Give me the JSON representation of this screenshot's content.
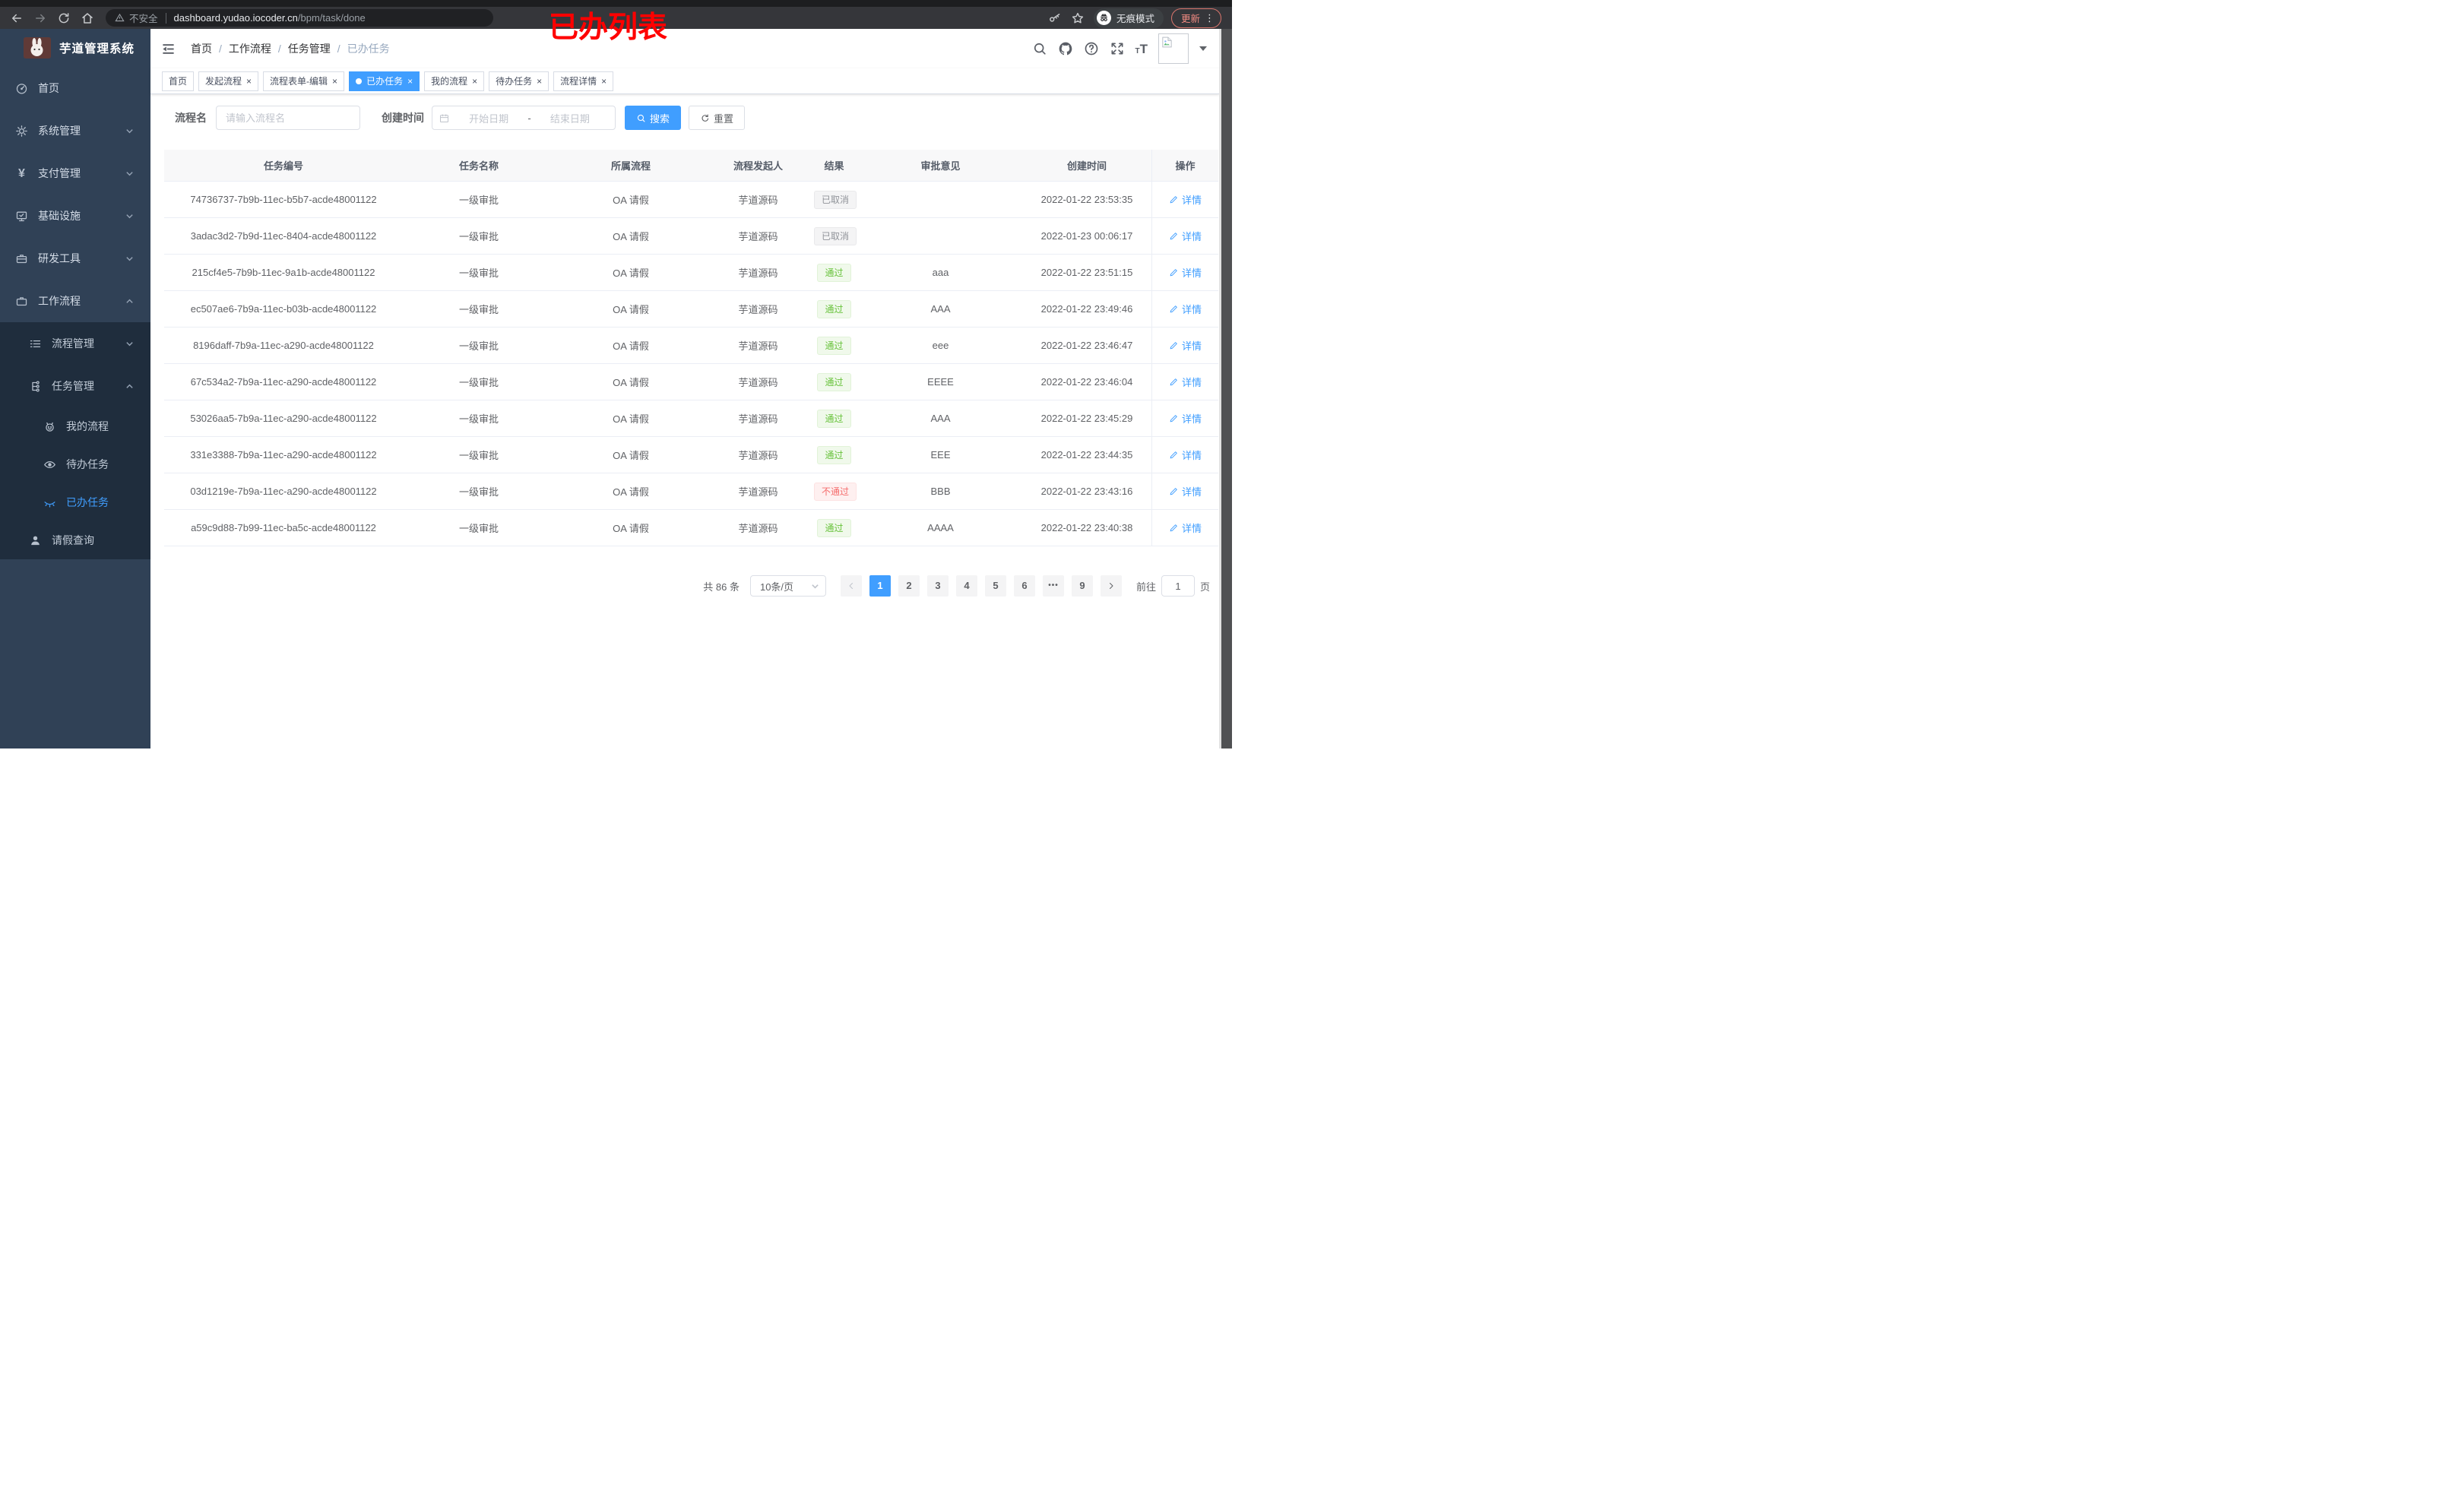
{
  "browser": {
    "security_label": "不安全",
    "url_domain": "dashboard.yudao.iocoder.cn",
    "url_path": "/bpm/task/done",
    "incognito_label": "无痕模式",
    "update_label": "更新"
  },
  "annotation": {
    "text": "已办列表",
    "color": "#ff0000"
  },
  "sidebar": {
    "title": "芋道管理系统",
    "items": {
      "home": "首页",
      "system": "系统管理",
      "pay": "支付管理",
      "infra": "基础设施",
      "dev": "研发工具",
      "workflow": "工作流程",
      "process_mgmt": "流程管理",
      "task_mgmt": "任务管理",
      "my_process": "我的流程",
      "todo": "待办任务",
      "done": "已办任务",
      "leave_query": "请假查询"
    }
  },
  "header": {
    "breadcrumbs": [
      "首页",
      "工作流程",
      "任务管理",
      "已办任务"
    ],
    "separator": "/"
  },
  "tabs": [
    {
      "label": "首页"
    },
    {
      "label": "发起流程"
    },
    {
      "label": "流程表单-编辑"
    },
    {
      "label": "已办任务",
      "active": true
    },
    {
      "label": "我的流程"
    },
    {
      "label": "待办任务"
    },
    {
      "label": "流程详情"
    }
  ],
  "filters": {
    "name_label": "流程名",
    "name_placeholder": "请输入流程名",
    "time_label": "创建时间",
    "start_placeholder": "开始日期",
    "range_separator": "-",
    "end_placeholder": "结束日期",
    "search_label": "搜索",
    "reset_label": "重置"
  },
  "table": {
    "columns": [
      "任务编号",
      "任务名称",
      "所属流程",
      "流程发起人",
      "结果",
      "审批意见",
      "创建时间",
      "操作"
    ],
    "detail_label": "详情",
    "rows": [
      {
        "id": "74736737-7b9b-11ec-b5b7-acde48001122",
        "name": "一级审批",
        "process": "OA 请假",
        "starter": "芋道源码",
        "result": "已取消",
        "result_type": "info",
        "comment": "",
        "created": "2022-01-22 23:53:35"
      },
      {
        "id": "3adac3d2-7b9d-11ec-8404-acde48001122",
        "name": "一级审批",
        "process": "OA 请假",
        "starter": "芋道源码",
        "result": "已取消",
        "result_type": "info",
        "comment": "",
        "created": "2022-01-23 00:06:17"
      },
      {
        "id": "215cf4e5-7b9b-11ec-9a1b-acde48001122",
        "name": "一级审批",
        "process": "OA 请假",
        "starter": "芋道源码",
        "result": "通过",
        "result_type": "success",
        "comment": "aaa",
        "created": "2022-01-22 23:51:15"
      },
      {
        "id": "ec507ae6-7b9a-11ec-b03b-acde48001122",
        "name": "一级审批",
        "process": "OA 请假",
        "starter": "芋道源码",
        "result": "通过",
        "result_type": "success",
        "comment": "AAA",
        "created": "2022-01-22 23:49:46"
      },
      {
        "id": "8196daff-7b9a-11ec-a290-acde48001122",
        "name": "一级审批",
        "process": "OA 请假",
        "starter": "芋道源码",
        "result": "通过",
        "result_type": "success",
        "comment": "eee",
        "created": "2022-01-22 23:46:47"
      },
      {
        "id": "67c534a2-7b9a-11ec-a290-acde48001122",
        "name": "一级审批",
        "process": "OA 请假",
        "starter": "芋道源码",
        "result": "通过",
        "result_type": "success",
        "comment": "EEEE",
        "created": "2022-01-22 23:46:04"
      },
      {
        "id": "53026aa5-7b9a-11ec-a290-acde48001122",
        "name": "一级审批",
        "process": "OA 请假",
        "starter": "芋道源码",
        "result": "通过",
        "result_type": "success",
        "comment": "AAA",
        "created": "2022-01-22 23:45:29"
      },
      {
        "id": "331e3388-7b9a-11ec-a290-acde48001122",
        "name": "一级审批",
        "process": "OA 请假",
        "starter": "芋道源码",
        "result": "通过",
        "result_type": "success",
        "comment": "EEE",
        "created": "2022-01-22 23:44:35"
      },
      {
        "id": "03d1219e-7b9a-11ec-a290-acde48001122",
        "name": "一级审批",
        "process": "OA 请假",
        "starter": "芋道源码",
        "result": "不通过",
        "result_type": "danger",
        "comment": "BBB",
        "created": "2022-01-22 23:43:16"
      },
      {
        "id": "a59c9d88-7b99-11ec-ba5c-acde48001122",
        "name": "一级审批",
        "process": "OA 请假",
        "starter": "芋道源码",
        "result": "通过",
        "result_type": "success",
        "comment": "AAAA",
        "created": "2022-01-22 23:40:38"
      }
    ]
  },
  "pagination": {
    "total_label": "共 86 条",
    "page_size": "10条/页",
    "pages": [
      "1",
      "2",
      "3",
      "4",
      "5",
      "6",
      "•••",
      "9"
    ],
    "active_page": "1",
    "goto_label": "前往",
    "goto_value": "1",
    "page_unit": "页"
  },
  "colors": {
    "accent": "#409eff",
    "success": "#67c23a",
    "danger": "#f56c6c",
    "info": "#909399",
    "sidebar": "#304156",
    "submenu": "#1f2d3d"
  }
}
